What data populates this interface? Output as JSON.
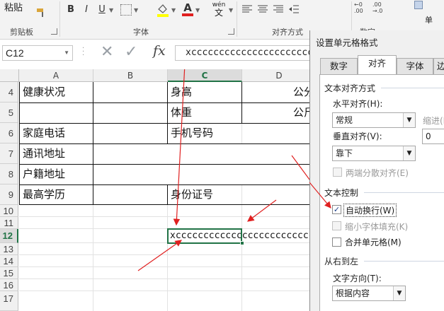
{
  "ribbon": {
    "paste_label": "粘贴",
    "clipboard_label": "剪贴板",
    "font_label": "字体",
    "align_label": "对齐方式",
    "number_label": "数字",
    "bold": "B",
    "italic": "I",
    "underline": "U",
    "wen": "wén",
    "wen_sub": "文",
    "font_color_letter": "A",
    "extra_label": "单"
  },
  "formula_bar": {
    "name_box": "C12",
    "fx": "fx",
    "content": "xccccccccccccccccccccccc"
  },
  "sheet": {
    "columns": [
      "A",
      "B",
      "C",
      "D"
    ],
    "rows": [
      "4",
      "5",
      "6",
      "7",
      "8",
      "9",
      "10",
      "11",
      "12",
      "13",
      "14",
      "15",
      "16",
      "17"
    ],
    "cells": {
      "a4": "健康状况",
      "c4": "身高",
      "d4": "公分",
      "c5": "体重",
      "d5": "公斤",
      "a6": "家庭电话",
      "c6": "手机号码",
      "a7": "通讯地址",
      "a8": "户籍地址",
      "a9": "最高学历",
      "c9": "身份证号",
      "c12": "xccccccccccccccccccccccccccc"
    }
  },
  "dialog": {
    "title": "设置单元格格式",
    "tabs": [
      "数字",
      "对齐",
      "字体",
      "边"
    ],
    "active_tab": "对齐",
    "text_align_section": "文本对齐方式",
    "horizontal_label": "水平对齐(H):",
    "horizontal_value": "常规",
    "indent_label": "缩进(I",
    "indent_value": "0",
    "vertical_label": "垂直对齐(V):",
    "vertical_value": "靠下",
    "justify_distributed": "两端分散对齐(E)",
    "text_control_section": "文本控制",
    "wrap_text": "自动换行(W)",
    "wrap_text_checked": true,
    "shrink_to_fit": "缩小字体填充(K)",
    "merge_cells": "合并单元格(M)",
    "rtl_section": "从右到左",
    "text_direction_label": "文字方向(T):",
    "text_direction_value": "根据内容"
  },
  "colors": {
    "accent_green": "#217346",
    "arrow_red": "#e02020",
    "check_blue": "#1d3f8a"
  }
}
